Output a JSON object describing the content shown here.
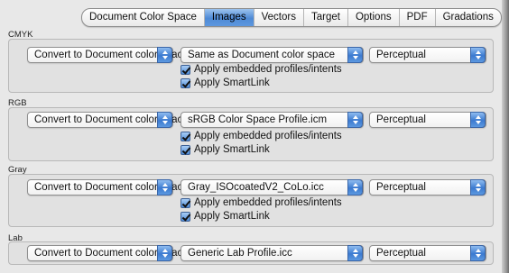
{
  "tabs": [
    {
      "label": "Document Color Space",
      "active": false
    },
    {
      "label": "Images",
      "active": true
    },
    {
      "label": "Vectors",
      "active": false
    },
    {
      "label": "Target",
      "active": false
    },
    {
      "label": "Options",
      "active": false
    },
    {
      "label": "PDF",
      "active": false
    },
    {
      "label": "Gradations",
      "active": false
    }
  ],
  "sections": {
    "cmyk": {
      "title": "CMYK",
      "action": "Convert to Document color space",
      "profile": "Same as Document color space",
      "intent": "Perceptual",
      "embedded_label": "Apply embedded profiles/intents",
      "embedded_checked": true,
      "smartlink_label": "Apply SmartLink",
      "smartlink_checked": true
    },
    "rgb": {
      "title": "RGB",
      "action": "Convert to Document color space",
      "profile": "sRGB Color Space Profile.icm",
      "intent": "Perceptual",
      "embedded_label": "Apply embedded profiles/intents",
      "embedded_checked": true,
      "smartlink_label": "Apply SmartLink",
      "smartlink_checked": true
    },
    "gray": {
      "title": "Gray",
      "action": "Convert to Document color space",
      "profile": "Gray_ISOcoatedV2_CoLo.icc",
      "intent": "Perceptual",
      "embedded_label": "Apply embedded profiles/intents",
      "embedded_checked": true,
      "smartlink_label": "Apply SmartLink",
      "smartlink_checked": true
    },
    "lab": {
      "title": "Lab",
      "action": "Convert to Document color space",
      "profile": "Generic Lab Profile.icc",
      "intent": "Perceptual"
    }
  }
}
